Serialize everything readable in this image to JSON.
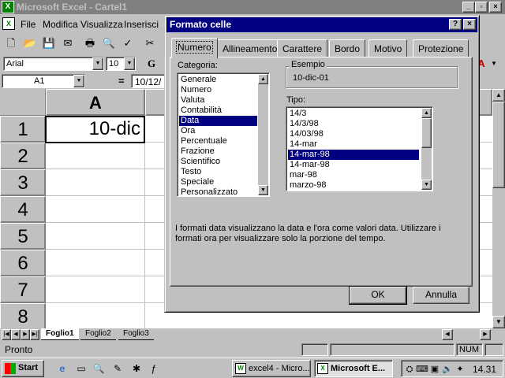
{
  "excel": {
    "title": "Microsoft Excel - Cartel1",
    "menu": [
      "File",
      "Modifica",
      "Visualizza",
      "Inserisci"
    ],
    "font_name": "Arial",
    "font_size": "10",
    "bold_label": "G",
    "name_box": "A1",
    "formula_eq": "=",
    "formula_value": "10/12/",
    "column_header": "A",
    "rows": [
      "1",
      "2",
      "3",
      "4",
      "5",
      "6",
      "7",
      "8"
    ],
    "cell_a1": "10-dic",
    "sheets": [
      "Foglio1",
      "Foglio2",
      "Foglio3"
    ],
    "status": "Pronto",
    "num_indicator": "NUM"
  },
  "dialog": {
    "title": "Formato celle",
    "help_btn": "?",
    "close_btn": "×",
    "tabs": [
      "Numero",
      "Allineamento",
      "Carattere",
      "Bordo",
      "Motivo",
      "Protezione"
    ],
    "category_label": "Categoria:",
    "categories": [
      "Generale",
      "Numero",
      "Valuta",
      "Contabilità",
      "Data",
      "Ora",
      "Percentuale",
      "Frazione",
      "Scientifico",
      "Testo",
      "Speciale",
      "Personalizzato"
    ],
    "selected_category": "Data",
    "sample_label": "Esempio",
    "sample_value": "10-dic-01",
    "type_label": "Tipo:",
    "types": [
      "14/3",
      "14/3/98",
      "14/03/98",
      "14-mar",
      "14-mar-98",
      "14-mar-98",
      "mar-98",
      "marzo-98"
    ],
    "selected_type": "14-mar-98",
    "description": "I formati data visualizzano la data e l'ora come valori data. Utilizzare i formati ora per visualizzare solo la porzione del tempo.",
    "ok_label": "OK",
    "cancel_label": "Annulla"
  },
  "taskbar": {
    "start_label": "Start",
    "tasks": [
      "excel4 - Micro...",
      "Microsoft E..."
    ],
    "clock": "14.31"
  },
  "colors": {
    "title_active": "#000080",
    "title_inactive": "#808080",
    "face": "#c0c0c0",
    "desktop": "#008080"
  }
}
